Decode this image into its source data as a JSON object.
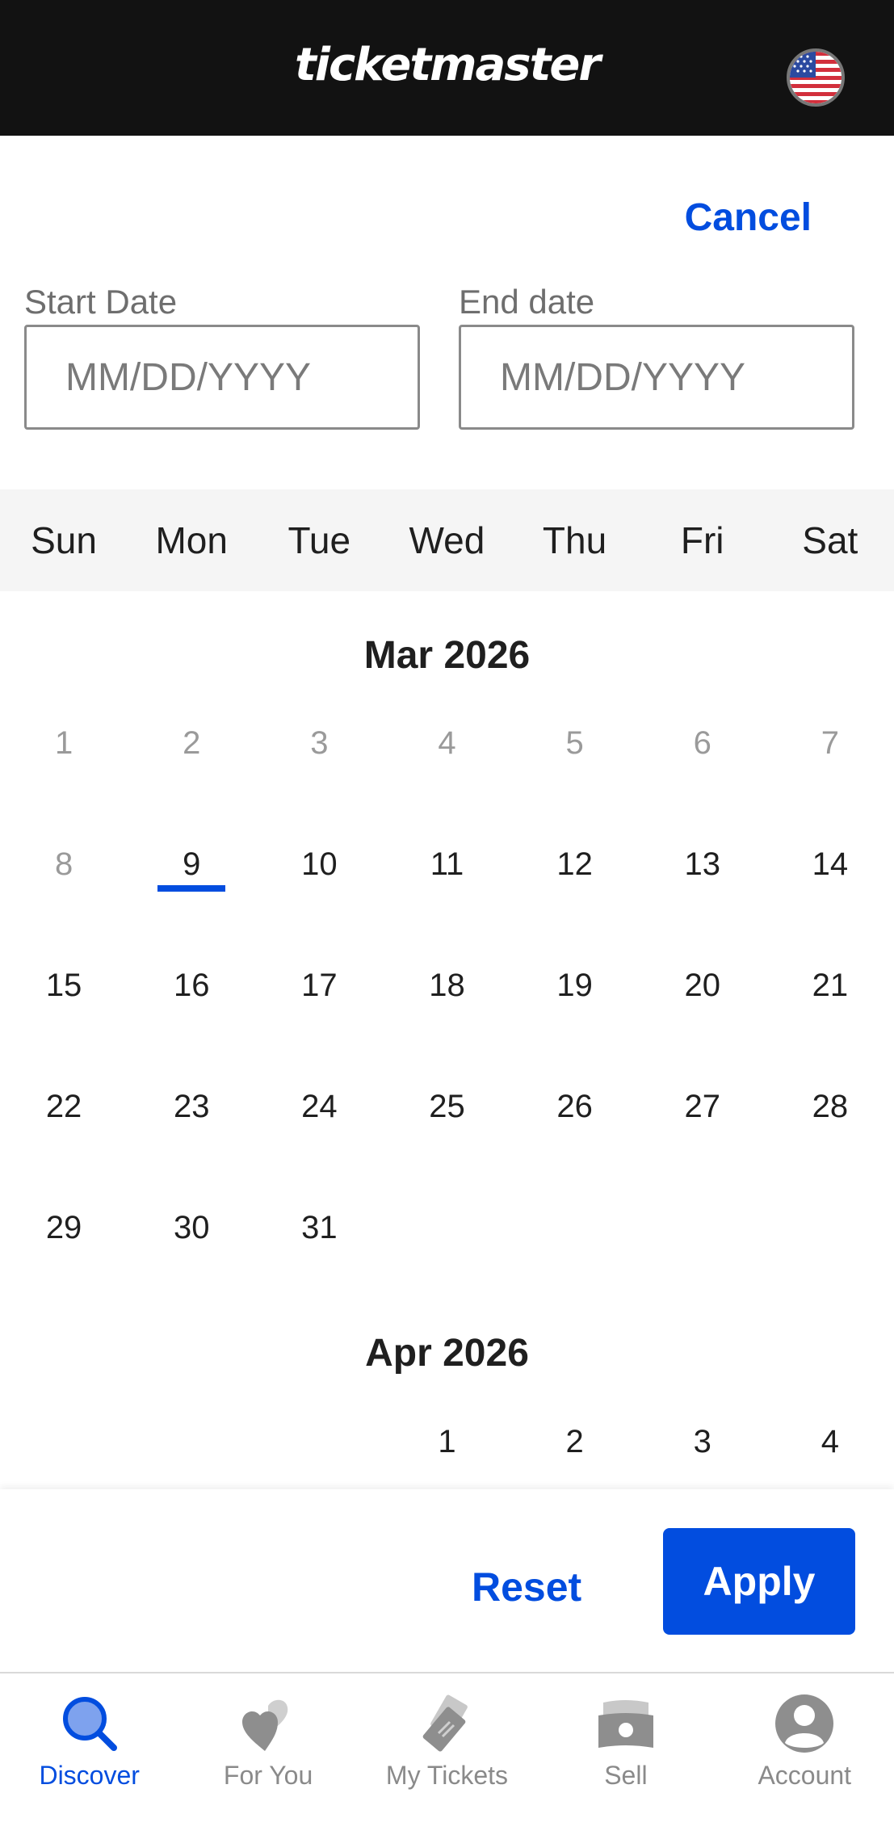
{
  "header": {
    "logo_text": "ticketmaster",
    "flag_icon": "us-flag-icon"
  },
  "picker": {
    "cancel_label": "Cancel",
    "start_label": "Start Date",
    "end_label": "End date",
    "start_placeholder": "MM/DD/YYYY",
    "end_placeholder": "MM/DD/YYYY"
  },
  "weekdays": [
    "Sun",
    "Mon",
    "Tue",
    "Wed",
    "Thu",
    "Fri",
    "Sat"
  ],
  "months": [
    {
      "title": "Mar 2026",
      "first_weekday": 0,
      "days": 31,
      "past_through": 8,
      "today": 9
    },
    {
      "title": "Apr 2026",
      "first_weekday": 3,
      "days_visible": 4
    }
  ],
  "footer": {
    "reset_label": "Reset",
    "apply_label": "Apply"
  },
  "tabs": [
    {
      "label": "Discover",
      "icon": "search-icon",
      "active": true
    },
    {
      "label": "For You",
      "icon": "hearts-icon",
      "active": false
    },
    {
      "label": "My Tickets",
      "icon": "tickets-icon",
      "active": false
    },
    {
      "label": "Sell",
      "icon": "cash-icon",
      "active": false
    },
    {
      "label": "Account",
      "icon": "account-icon",
      "active": false
    }
  ],
  "colors": {
    "accent": "#024ddf",
    "header_bg": "#121212",
    "weekbar_bg": "#f5f5f5",
    "muted": "#9a9a9a"
  }
}
